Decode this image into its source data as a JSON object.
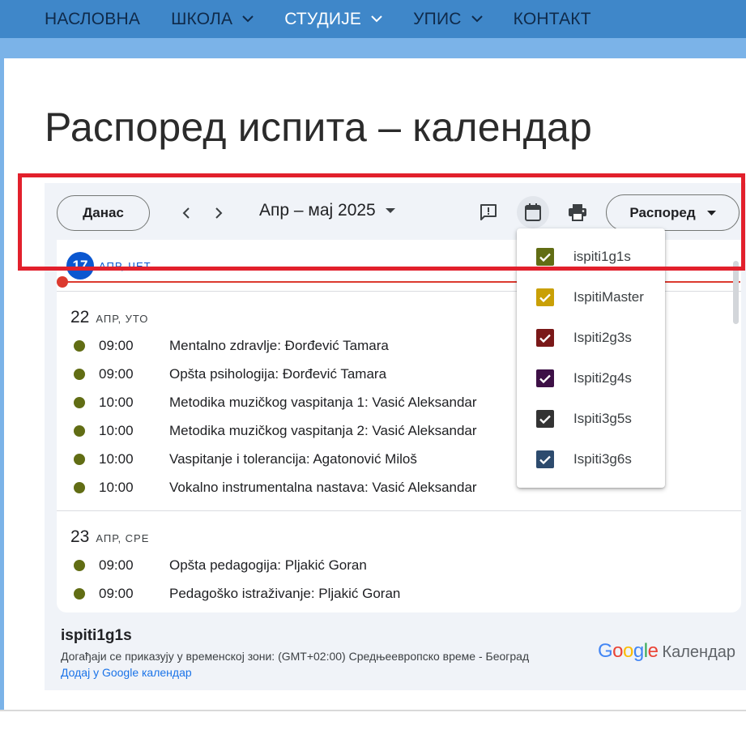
{
  "nav": {
    "items": [
      {
        "label": "НАСЛОВНА",
        "has_dropdown": false
      },
      {
        "label": "ШКОЛА",
        "has_dropdown": true
      },
      {
        "label": "СТУДИЈЕ",
        "has_dropdown": true,
        "active": true
      },
      {
        "label": "УПИС",
        "has_dropdown": true
      },
      {
        "label": "КОНТАКТ",
        "has_dropdown": false
      }
    ]
  },
  "page": {
    "title": "Распоред испита – календар"
  },
  "calendar": {
    "today_label": "Данас",
    "range_label": "Апр – мај 2025",
    "view_label": "Распоред",
    "today": {
      "num": "17",
      "label": "АПР, ЧЕТ"
    },
    "days": [
      {
        "num": "22",
        "label": "АПР, УТО",
        "events": [
          {
            "time": "09:00",
            "title": "Mentalno zdravlje: Đorđević Tamara"
          },
          {
            "time": "09:00",
            "title": "Opšta psihologija: Đorđević Tamara"
          },
          {
            "time": "10:00",
            "title": "Metodika muzičkog vaspitanja 1: Vasić Aleksandar"
          },
          {
            "time": "10:00",
            "title": "Metodika muzičkog vaspitanja 2: Vasić Aleksandar"
          },
          {
            "time": "10:00",
            "title": "Vaspitanje i tolerancija: Agatonović Miloš"
          },
          {
            "time": "10:00",
            "title": "Vokalno instrumentalna nastava: Vasić Aleksandar"
          }
        ]
      },
      {
        "num": "23",
        "label": "АПР, СРЕ",
        "events": [
          {
            "time": "09:00",
            "title": "Opšta pedagogija: Pljakić Goran"
          },
          {
            "time": "09:00",
            "title": "Pedagoško istraživanje: Pljakić Goran"
          }
        ]
      }
    ],
    "calendars_menu": [
      {
        "label": "ispiti1g1s",
        "color": "#616d14",
        "checked": true
      },
      {
        "label": "IspitiMaster",
        "color": "#c9a006",
        "checked": true
      },
      {
        "label": "Ispiti2g3s",
        "color": "#7a1818",
        "checked": true
      },
      {
        "label": "Ispiti2g4s",
        "color": "#3d1046",
        "checked": true
      },
      {
        "label": "Ispiti3g5s",
        "color": "#333333",
        "checked": true
      },
      {
        "label": "Ispiti3g6s",
        "color": "#2d4b6e",
        "checked": true
      }
    ],
    "footer": {
      "title": "ispiti1g1s",
      "timezone": "Догађаји се приказују у временској зони: (GMT+02:00) Средњеевропско време - Београд",
      "add_link": "Додај у Google календар",
      "brand_google": "Google",
      "brand_calendar": "Календар"
    }
  },
  "colors": {
    "event_dot": "#616d14",
    "today_blue": "#0b57d0",
    "now_line": "#dc3a2f",
    "highlight": "#e2202c"
  }
}
